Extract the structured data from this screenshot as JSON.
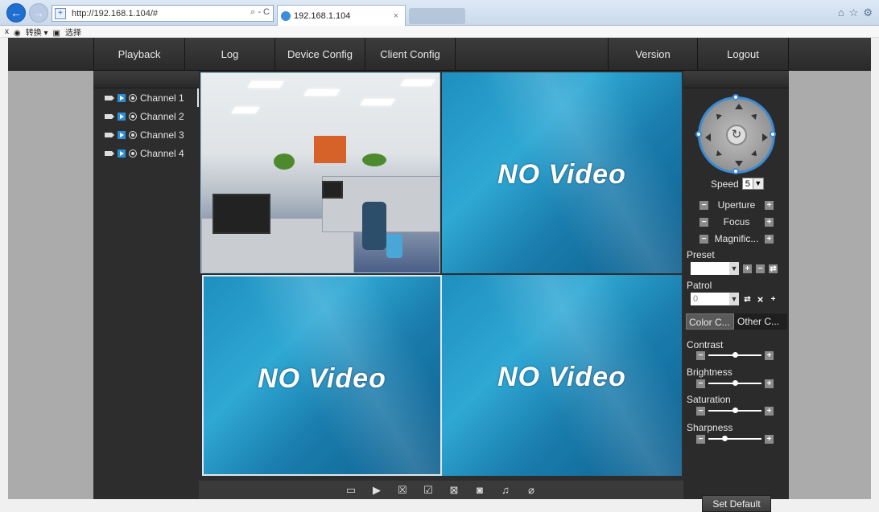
{
  "browser": {
    "url": "http://192.168.1.104/#",
    "tab_title": "192.168.1.104",
    "search_glyph": "⌕ - C",
    "tab_close": "×",
    "back_glyph": "←",
    "fwd_glyph": "→",
    "cmd_close": "x",
    "cmd_item_1": "转换",
    "cmd_item_2": "选择"
  },
  "nav": {
    "playback": "Playback",
    "log": "Log",
    "device_config": "Device Config",
    "client_config": "Client Config",
    "version": "Version",
    "logout": "Logout"
  },
  "channels": [
    {
      "label": "Channel 1"
    },
    {
      "label": "Channel 2"
    },
    {
      "label": "Channel 3"
    },
    {
      "label": "Channel 4"
    }
  ],
  "video": {
    "no_video_label": "NO Video"
  },
  "ptz": {
    "speed_label": "Speed",
    "speed_value": "5",
    "uperture_label": "Uperture",
    "focus_label": "Focus",
    "magnific_label": "Magnific...",
    "preset_label": "Preset",
    "preset_value": "",
    "patrol_label": "Patrol",
    "patrol_value": "0",
    "tab_color": "Color C...",
    "tab_other": "Other C...",
    "contrast_label": "Contrast",
    "brightness_label": "Brightness",
    "saturation_label": "Saturation",
    "sharpness_label": "Sharpness",
    "contrast_level": 0.5,
    "brightness_level": 0.5,
    "saturation_level": 0.5,
    "sharpness_level": 0.3,
    "set_default_label": "Set Default"
  },
  "colors": {
    "accent_blue": "#3a8bd6",
    "panel_dark": "#2b2b2b",
    "video_blue": "#1e8fbf"
  }
}
